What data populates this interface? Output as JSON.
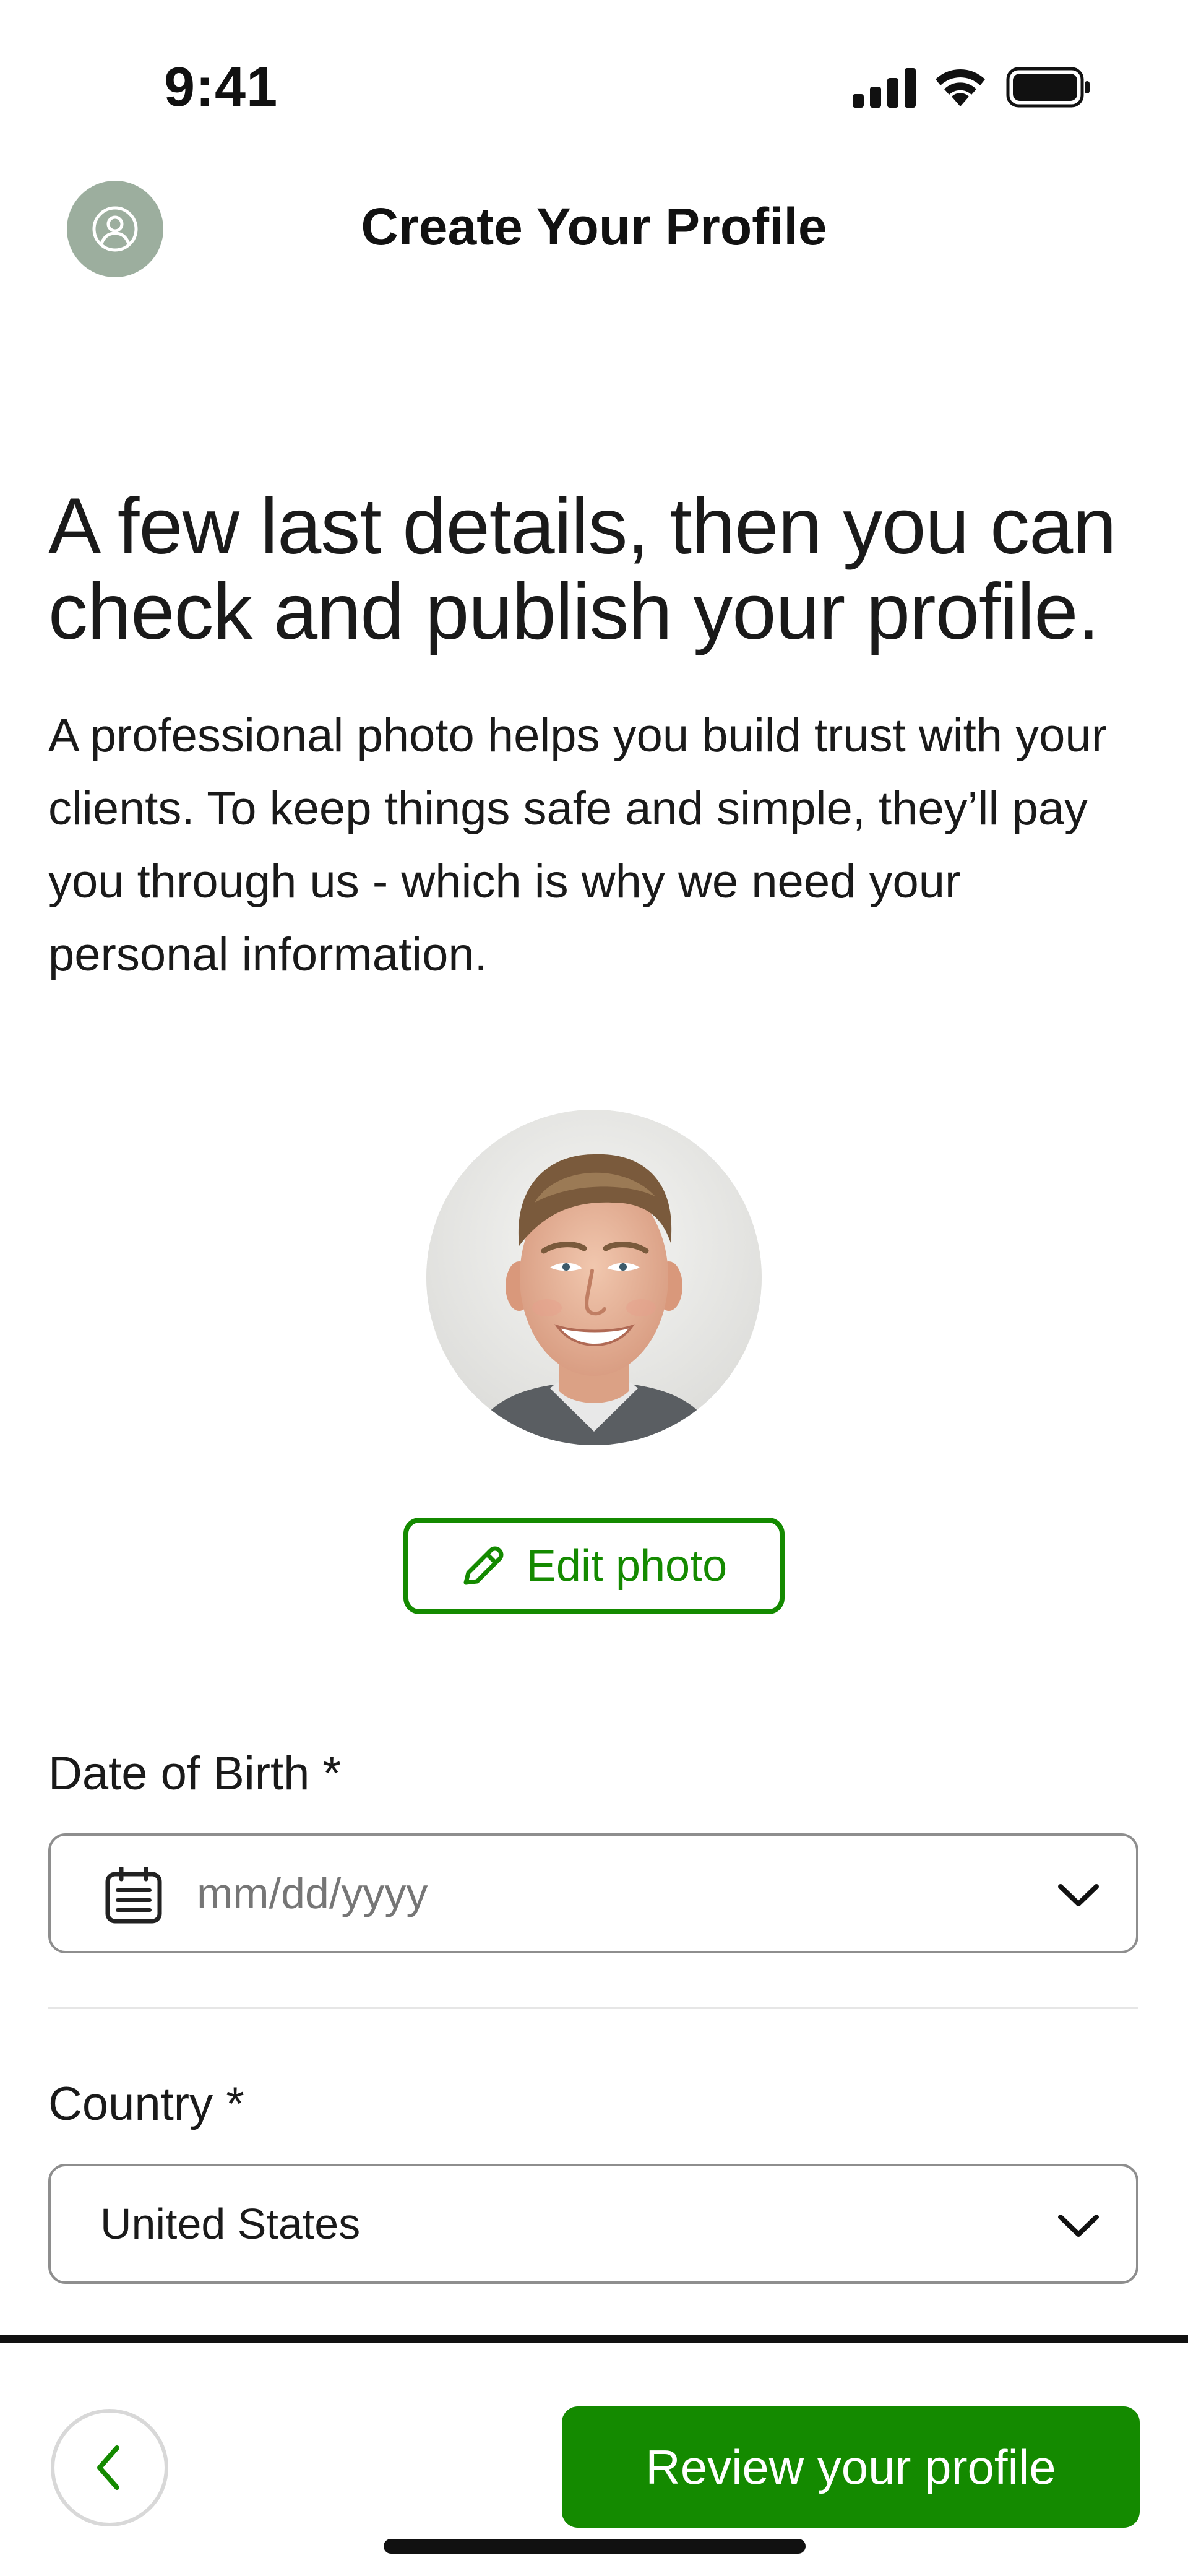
{
  "status_bar": {
    "time": "9:41"
  },
  "header": {
    "title": "Create Your Profile",
    "profile_icon": "person-circle-icon"
  },
  "headline": "A few last details, then you can check and publish your profile.",
  "intro": "A professional photo helps you build trust with your clients. To keep things safe and simple, they’ll pay you through us - which is why we need your personal information.",
  "photo": {
    "edit_label": "Edit photo",
    "edit_icon": "pencil-icon"
  },
  "form": {
    "dob": {
      "label": "Date of Birth *",
      "placeholder": "mm/dd/yyyy",
      "icon": "calendar-icon"
    },
    "country": {
      "label": "Country *",
      "value": "United States"
    }
  },
  "footer": {
    "back_icon": "chevron-left-icon",
    "review_label": "Review your profile"
  },
  "colors": {
    "accent": "#148a00",
    "avatar_bg": "#9cae9e",
    "border": "#8e8e8e",
    "placeholder": "#767676"
  }
}
